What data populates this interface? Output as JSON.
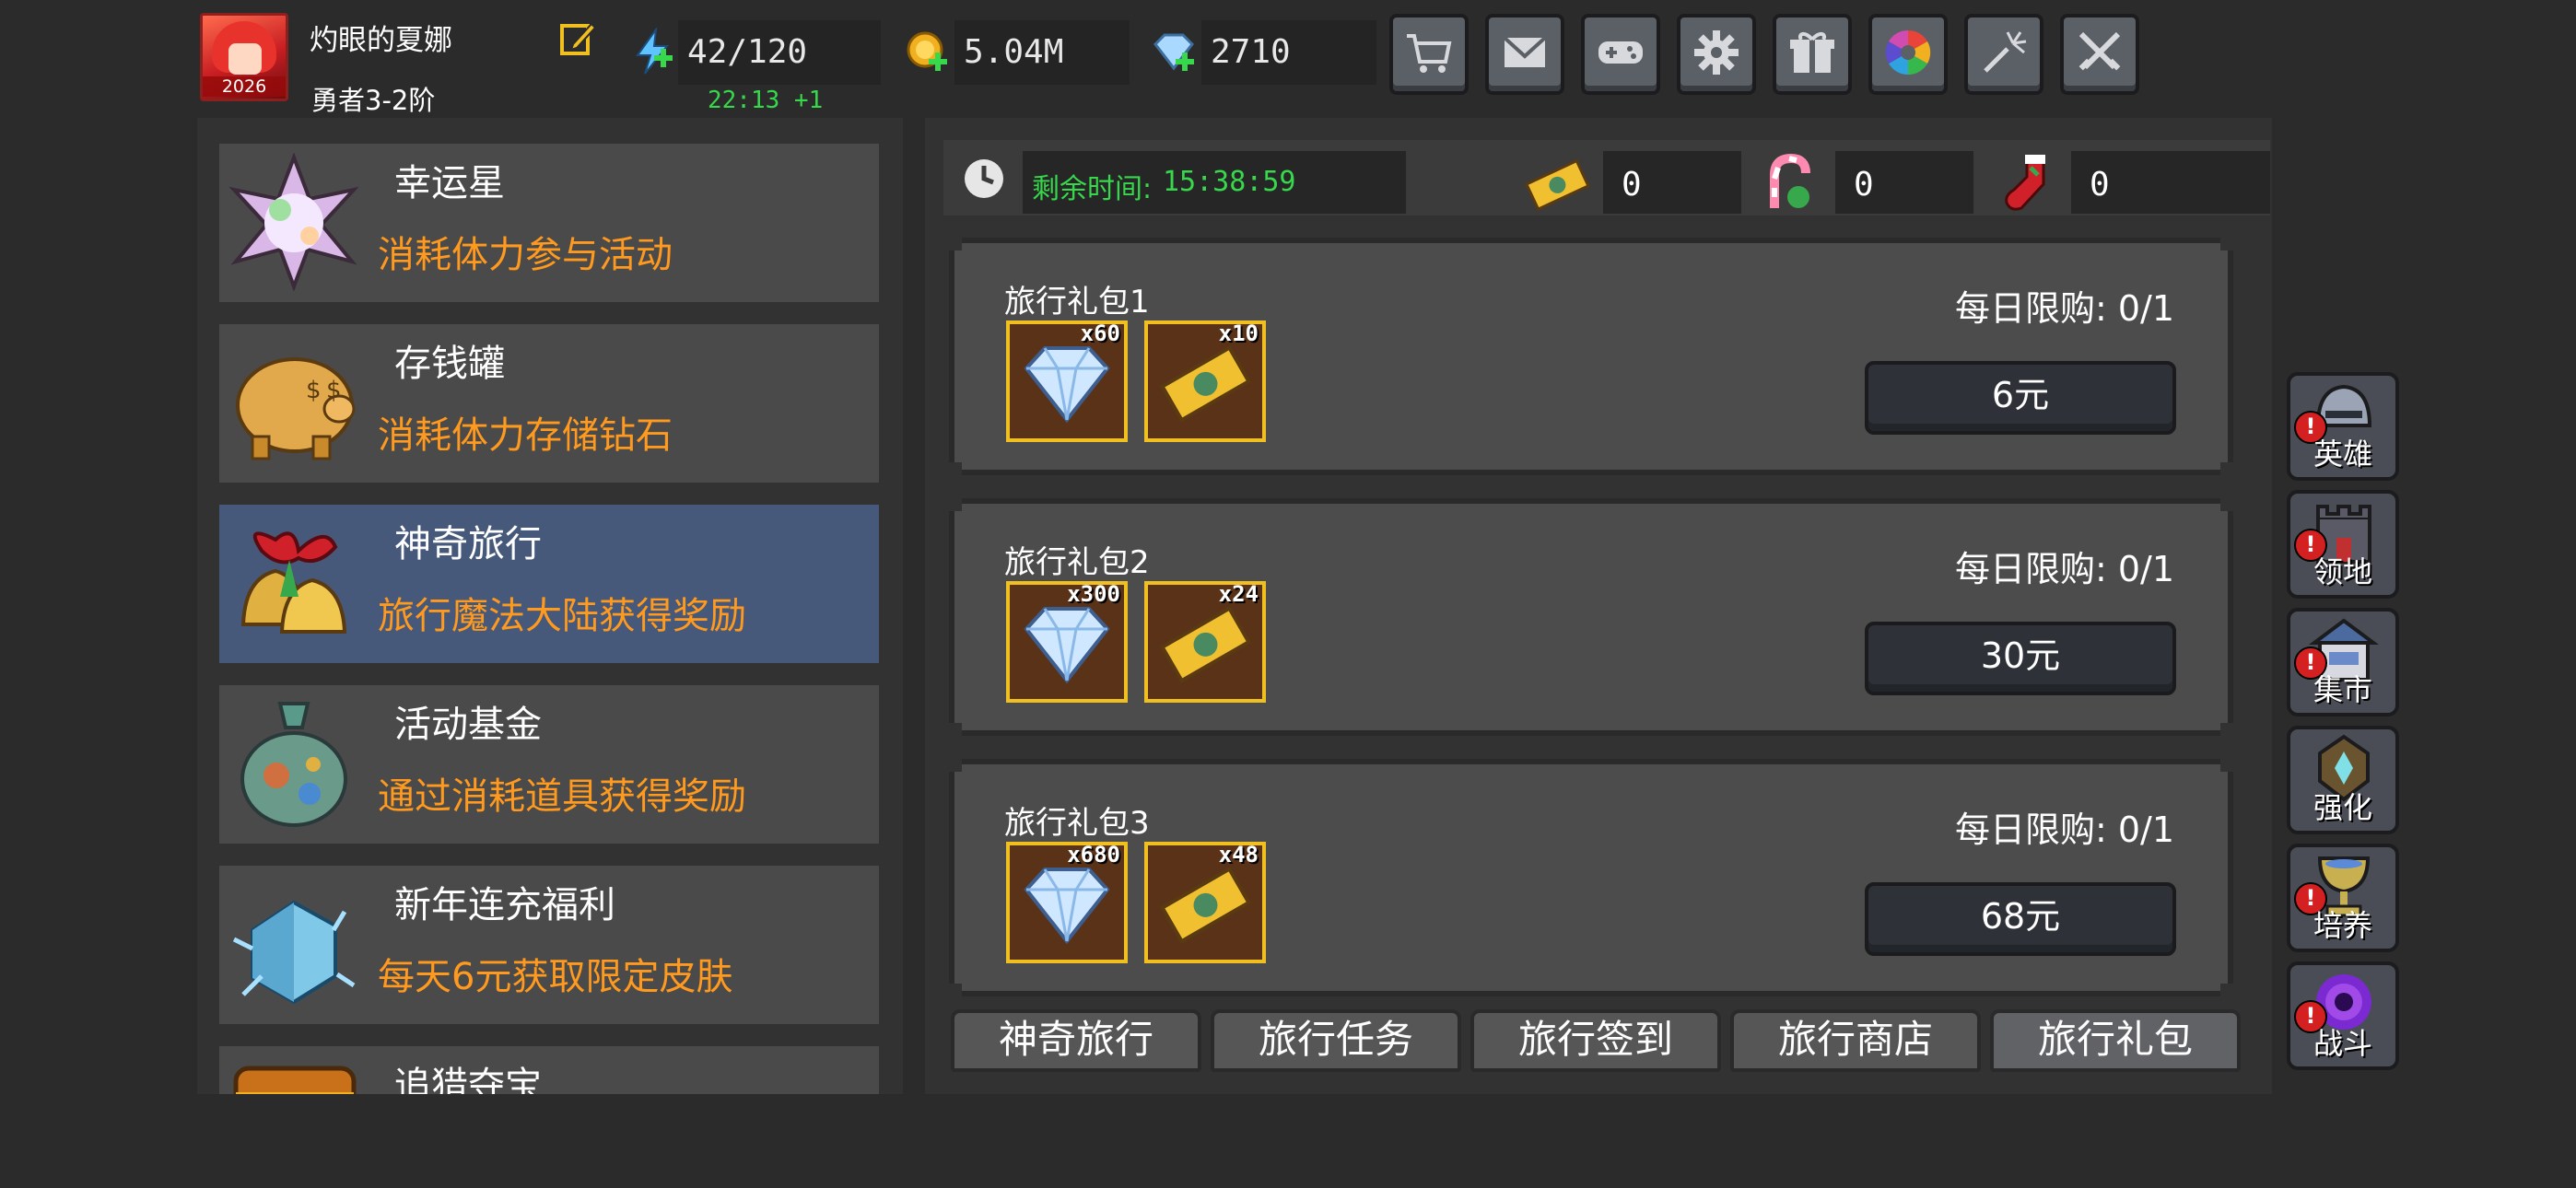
{
  "player": {
    "name": "灼眼的夏娜",
    "rank": "勇者3-2阶",
    "avatar_year": "2026"
  },
  "resources": {
    "stamina": "42/120",
    "stamina_timer": "22:13 +1",
    "gold": "5.04M",
    "diamonds": "2710"
  },
  "toolbar_icons": [
    "cart-icon",
    "mail-icon",
    "gamepad-icon",
    "gear-icon",
    "gift-icon",
    "color-wheel-icon",
    "firework-icon",
    "crossed-swords-icon"
  ],
  "events": [
    {
      "title": "幸运星",
      "subtitle": "消耗体力参与活动",
      "icon": "lucky-star-icon"
    },
    {
      "title": "存钱罐",
      "subtitle": "消耗体力存储钻石",
      "icon": "piggy-bank-icon"
    },
    {
      "title": "神奇旅行",
      "subtitle": "旅行魔法大陆获得奖励",
      "icon": "bells-icon",
      "active": true
    },
    {
      "title": "活动基金",
      "subtitle": "通过消耗道具获得奖励",
      "icon": "money-bag-icon"
    },
    {
      "title": "新年连充福利",
      "subtitle": "每天6元获取限定皮肤",
      "icon": "ice-crystal-icon"
    },
    {
      "title": "追猎夺宝",
      "subtitle": "",
      "icon": "treasure-chest-icon"
    }
  ],
  "shop": {
    "timer_label": "剩余时间:",
    "timer_value": "15:38:59",
    "currencies": [
      {
        "icon": "ticket-icon",
        "value": "0"
      },
      {
        "icon": "candy-cane-icon",
        "value": "0"
      },
      {
        "icon": "stocking-icon",
        "value": "0"
      }
    ],
    "packs": [
      {
        "name": "旅行礼包1",
        "limit": "每日限购: 0/1",
        "price": "6元",
        "items": [
          {
            "icon": "diamond-icon",
            "count": "x60"
          },
          {
            "icon": "ticket-icon",
            "count": "x10"
          }
        ]
      },
      {
        "name": "旅行礼包2",
        "limit": "每日限购: 0/1",
        "price": "30元",
        "items": [
          {
            "icon": "diamond-icon",
            "count": "x300"
          },
          {
            "icon": "ticket-icon",
            "count": "x24"
          }
        ]
      },
      {
        "name": "旅行礼包3",
        "limit": "每日限购: 0/1",
        "price": "68元",
        "items": [
          {
            "icon": "diamond-icon",
            "count": "x680"
          },
          {
            "icon": "ticket-icon",
            "count": "x48"
          }
        ]
      }
    ],
    "tabs": [
      "神奇旅行",
      "旅行任务",
      "旅行签到",
      "旅行商店",
      "旅行礼包"
    ],
    "active_tab": "旅行礼包"
  },
  "nav": [
    {
      "label": "英雄",
      "icon": "helmet-icon",
      "alert": "!"
    },
    {
      "label": "领地",
      "icon": "castle-icon",
      "alert": "!"
    },
    {
      "label": "集市",
      "icon": "market-icon",
      "alert": "!"
    },
    {
      "label": "强化",
      "icon": "enhance-crest-icon",
      "alert": ""
    },
    {
      "label": "培养",
      "icon": "chalice-icon",
      "alert": "!"
    },
    {
      "label": "战斗",
      "icon": "vortex-icon",
      "alert": "!"
    }
  ],
  "colors": {
    "background": "#2b2b2b",
    "panel": "#323232",
    "row": "#4a4a4a",
    "row_active": "#46597a",
    "subtitle_orange": "#ff9a1f",
    "timer_green": "#37d84c",
    "item_border_gold": "#f0c020"
  }
}
